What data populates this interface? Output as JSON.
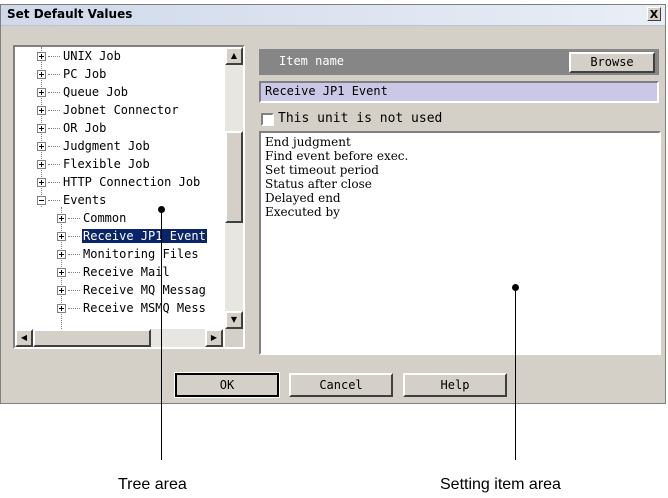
{
  "window": {
    "title": "Set Default Values",
    "close_label": "X"
  },
  "tree": {
    "nodes": [
      {
        "label": "UNIX Job"
      },
      {
        "label": "PC Job"
      },
      {
        "label": "Queue Job"
      },
      {
        "label": "Jobnet Connector"
      },
      {
        "label": "OR Job"
      },
      {
        "label": "Judgment Job"
      },
      {
        "label": "Flexible Job"
      },
      {
        "label": "HTTP Connection Job"
      },
      {
        "label": "Events"
      },
      {
        "label": "Common"
      },
      {
        "label": "Receive JP1 Event"
      },
      {
        "label": "Monitoring Files"
      },
      {
        "label": "Receive Mail"
      },
      {
        "label": "Receive MQ Messag"
      },
      {
        "label": "Receive MSMQ Mess"
      }
    ],
    "selected": "Receive JP1 Event",
    "scroll_up": "▲",
    "scroll_down": "▼",
    "scroll_left": "◀",
    "scroll_right": "▶"
  },
  "item": {
    "header_label": "Item name",
    "browse_label": "Browse",
    "value": "Receive JP1 Event"
  },
  "unused_checkbox": {
    "label": "This unit is not used",
    "checked": false
  },
  "settings": [
    "End judgment",
    "Find event before exec.",
    "Set timeout period",
    "Status after close",
    "Delayed end",
    "Executed by"
  ],
  "buttons": {
    "ok": "OK",
    "cancel": "Cancel",
    "help": "Help"
  },
  "annotations": {
    "tree_area": "Tree area",
    "setting_item_area": "Setting item area"
  }
}
